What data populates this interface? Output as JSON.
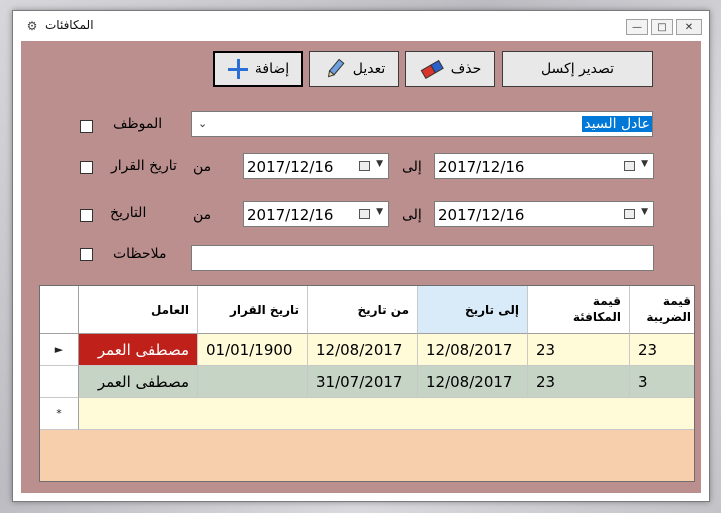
{
  "window": {
    "title": "المكافئات"
  },
  "toolbar": {
    "export_label": "تصدير إكسل",
    "delete_label": "حذف",
    "edit_label": "تعديل",
    "add_label": "إضافة"
  },
  "filters": {
    "employee_label": "الموظف",
    "employee_value": "عادل السيد",
    "decision_date_label": "تاريخ القرار",
    "from_label": "من",
    "to_label": "إلى",
    "decision_from": "2017/12/16",
    "decision_to": "2017/12/16",
    "date_label": "التاريخ",
    "date_from": "2017/12/16",
    "date_to": "2017/12/16",
    "notes_label": "ملاحظات",
    "notes_value": ""
  },
  "grid": {
    "columns": [
      "العامل",
      "تاريخ القرار",
      "من تاريخ",
      "إلى تاريخ",
      "قيمة المكافئة",
      "قيمة الضريبة"
    ],
    "rows": [
      {
        "worker": "مصطفى العمر",
        "decision_date": "01/01/1900",
        "from_date": "12/08/2017",
        "to_date": "12/08/2017",
        "amount": "23",
        "tax": "23"
      },
      {
        "worker": "مصطفى العمر",
        "decision_date": "",
        "from_date": "31/07/2017",
        "to_date": "12/08/2017",
        "amount": "23",
        "tax": "3"
      }
    ],
    "new_row_marker": "*",
    "current_row_marker": "►"
  },
  "colors": {
    "client_bg": "#bc8f8f",
    "selected_cell": "#c0201a",
    "row_alt": "#c5d4c5",
    "row_base": "#fffbd9",
    "grid_empty": "#f8cfac"
  }
}
